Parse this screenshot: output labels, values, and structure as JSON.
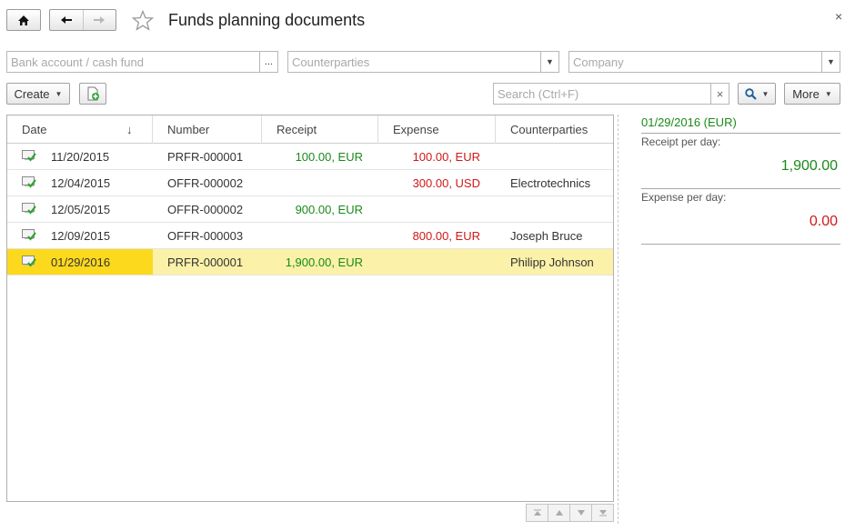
{
  "window": {
    "title": "Funds planning documents",
    "close_glyph": "×"
  },
  "nav": {
    "home_icon": "home-icon",
    "back_icon": "arrow-left-icon",
    "forward_icon": "arrow-right-icon",
    "favorite_icon": "star-icon"
  },
  "filters": {
    "bank_account": {
      "placeholder": "Bank account / cash fund",
      "value": "",
      "button": "..."
    },
    "counterparties": {
      "placeholder": "Counterparties",
      "value": ""
    },
    "company": {
      "placeholder": "Company",
      "value": ""
    }
  },
  "toolbar": {
    "create_label": "Create",
    "search_placeholder": "Search (Ctrl+F)",
    "clear_glyph": "×",
    "more_label": "More"
  },
  "table": {
    "columns": [
      "Date",
      "Number",
      "Receipt",
      "Expense",
      "Counterparties"
    ],
    "sort_indicator": "↓",
    "rows": [
      {
        "date": "11/20/2015",
        "number": "PRFR-000001",
        "receipt": "100.00, EUR",
        "expense": "100.00, EUR",
        "counterparty": ""
      },
      {
        "date": "12/04/2015",
        "number": "OFFR-000002",
        "receipt": "",
        "expense": "300.00, USD",
        "counterparty": "Electrotechnics"
      },
      {
        "date": "12/05/2015",
        "number": "OFFR-000002",
        "receipt": "900.00, EUR",
        "expense": "",
        "counterparty": ""
      },
      {
        "date": "12/09/2015",
        "number": "OFFR-000003",
        "receipt": "",
        "expense": "800.00, EUR",
        "counterparty": "Joseph Bruce"
      },
      {
        "date": "01/29/2016",
        "number": "PRFR-000001",
        "receipt": "1,900.00, EUR",
        "expense": "",
        "counterparty": "Philipp Johnson"
      }
    ],
    "selected_row": 4
  },
  "side_panel": {
    "date_currency": "01/29/2016 (EUR)",
    "receipt_label": "Receipt per day:",
    "receipt_value": "1,900.00",
    "expense_label": "Expense per day:",
    "expense_value": "0.00"
  },
  "colors": {
    "receipt": "#1a8a1a",
    "expense": "#d01818",
    "selection": "#fbf1a9",
    "selection_date": "#fcd91d"
  }
}
